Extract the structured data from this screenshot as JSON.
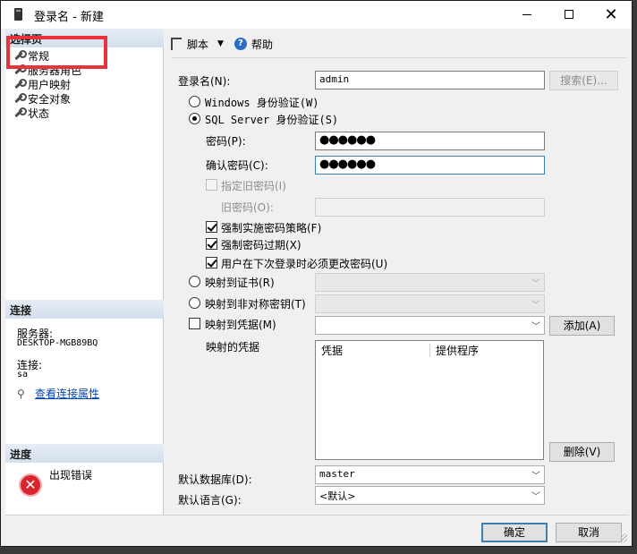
{
  "window": {
    "title": "登录名 - 新建"
  },
  "left": {
    "select_page_header": "选择页",
    "nav": [
      "常规",
      "服务器角色",
      "用户映射",
      "安全对象",
      "状态"
    ],
    "connection_header": "连接",
    "server_label": "服务器:",
    "server_value": "DESKTOP-MGB89BQ",
    "conn_label": "连接:",
    "conn_value": "sa",
    "view_props": "查看连接属性",
    "progress_header": "进度",
    "progress_status": "出现错误"
  },
  "toolbar": {
    "script": "脚本",
    "help": "帮助"
  },
  "form": {
    "login_label": "登录名(N):",
    "login_value": "admin",
    "search_button": "搜索(E)...",
    "windows_auth": "Windows 身份验证(W)",
    "sql_auth": "SQL Server 身份验证(S)",
    "password_label": "密码(P):",
    "password_dots": "●●●●●●",
    "confirm_label": "确认密码(C):",
    "confirm_dots": "●●●●●●",
    "old_pw_check": "指定旧密码(I)",
    "old_pw_label": "旧密码(O):",
    "enforce_policy": "强制实施密码策略(F)",
    "enforce_expire": "强制密码过期(X)",
    "must_change": "用户在下次登录时必须更改密码(U)",
    "map_cert": "映射到证书(R)",
    "map_asym": "映射到非对称密钥(T)",
    "map_cred": "映射到凭据(M)",
    "add_button": "添加(A)",
    "mapped_creds": "映射的凭据",
    "col_cred": "凭据",
    "col_provider": "提供程序",
    "remove_button": "删除(V)",
    "default_db_label": "默认数据库(D):",
    "default_db_value": "master",
    "default_lang_label": "默认语言(G):",
    "default_lang_value": "<默认>"
  },
  "footer": {
    "ok": "确定",
    "cancel": "取消"
  }
}
